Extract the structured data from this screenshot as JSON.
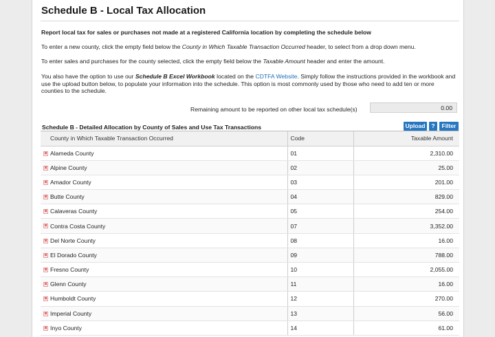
{
  "page": {
    "title": "Schedule B - Local Tax Allocation",
    "intro_bold": "Report local tax for sales or purchases not made at a registered California location by completing the schedule below",
    "para1_a": "To enter a new county, click the empty field below the ",
    "para1_i": "County in Which Taxable Transaction Occurred",
    "para1_b": " header, to select from a drop down menu.",
    "para2_a": "To enter sales and purchases for the county selected, click the empty field below the ",
    "para2_i": "Taxable Amount",
    "para2_b": " header and enter the amount.",
    "para3_a": "You also have the option to use our ",
    "para3_bi": "Schedule B Excel Workbook",
    "para3_b": " located on the ",
    "para3_link": "CDTFA Website",
    "para3_c": ". Simply follow the instructions provided in the workbook and use the upload button below, to populate your information into the schedule. This option is most commonly used by those who need to add ten or more counties to the schedule."
  },
  "remaining": {
    "label": "Remaining amount to be reported on other local tax schedule(s)",
    "value": "0.00"
  },
  "section": {
    "title": "Schedule B - Detailed Allocation by County of Sales and Use Tax Transactions",
    "upload_label": "Upload",
    "help_label": "?",
    "filter_label": "Filter"
  },
  "table": {
    "headers": {
      "county": "County in Which Taxable Transaction Occurred",
      "code": "Code",
      "amount": "Taxable Amount"
    },
    "rows": [
      {
        "county": "Alameda County",
        "code": "01",
        "amount": "2,310.00"
      },
      {
        "county": "Alpine County",
        "code": "02",
        "amount": "25.00"
      },
      {
        "county": "Amador County",
        "code": "03",
        "amount": "201.00"
      },
      {
        "county": "Butte County",
        "code": "04",
        "amount": "829.00"
      },
      {
        "county": "Calaveras County",
        "code": "05",
        "amount": "254.00"
      },
      {
        "county": "Contra Costa County",
        "code": "07",
        "amount": "3,352.00"
      },
      {
        "county": "Del Norte County",
        "code": "08",
        "amount": "16.00"
      },
      {
        "county": "El Dorado County",
        "code": "09",
        "amount": "788.00"
      },
      {
        "county": "Fresno County",
        "code": "10",
        "amount": "2,055.00"
      },
      {
        "county": "Glenn County",
        "code": "11",
        "amount": "16.00"
      },
      {
        "county": "Humboldt County",
        "code": "12",
        "amount": "270.00"
      },
      {
        "county": "Imperial County",
        "code": "13",
        "amount": "56.00"
      },
      {
        "county": "Inyo County",
        "code": "14",
        "amount": "61.00"
      }
    ],
    "delete_icon": "delete-x-icon"
  }
}
